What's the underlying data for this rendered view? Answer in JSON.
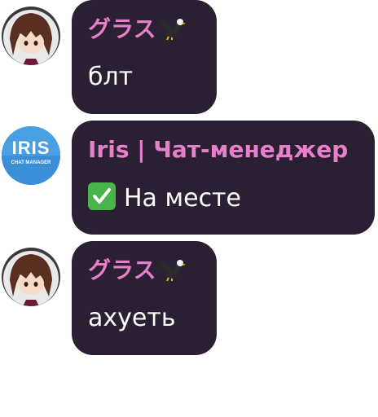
{
  "messages": [
    {
      "sender": "グラス",
      "text": "блт",
      "avatar_icon": "anime-character-avatar-icon",
      "sender_badge_icon": "eagle-icon"
    },
    {
      "sender": "Iris | Чат-менеджер",
      "text": "На месте",
      "text_icon": "check-mark-icon",
      "avatar": {
        "title": "IRIS",
        "subtitle": "CHAT MANAGER"
      }
    },
    {
      "sender": "グラス",
      "text": "ахуеть",
      "avatar_icon": "anime-character-avatar-icon",
      "sender_badge_icon": "eagle-icon"
    }
  ],
  "colors": {
    "bubble": "#2a1f33",
    "sender_name": "#e77fc9",
    "message_text": "#ffffff",
    "iris_avatar_bg": "#3a8fd6",
    "check_bg": "#4ab44a"
  }
}
